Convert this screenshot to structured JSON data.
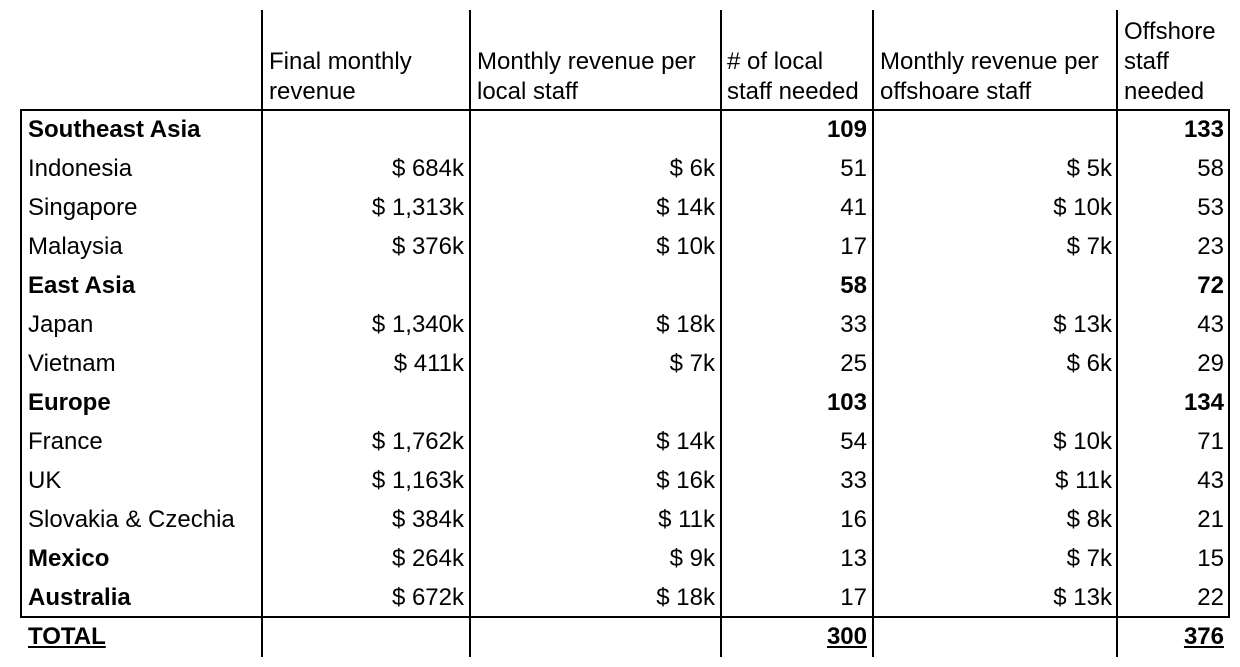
{
  "headers": {
    "final_revenue": "Final monthly\nrevenue",
    "rev_per_local": "Monthly revenue per\nlocal staff",
    "local_needed": "# of local\nstaff needed",
    "rev_per_offshore": "Monthly revenue per\noffshoare staff",
    "offshore_needed": "Offshore\nstaff\nneeded"
  },
  "rows": [
    {
      "name": "Southeast Asia",
      "bold": true,
      "revenue": "",
      "rev_local": "",
      "local": "109",
      "rev_offshore": "",
      "offshore": "133"
    },
    {
      "name": "Indonesia",
      "bold": false,
      "revenue": "$ 684k",
      "rev_local": "$ 6k",
      "local": "51",
      "rev_offshore": "$ 5k",
      "offshore": "58"
    },
    {
      "name": "Singapore",
      "bold": false,
      "revenue": "$ 1,313k",
      "rev_local": "$ 14k",
      "local": "41",
      "rev_offshore": "$ 10k",
      "offshore": "53"
    },
    {
      "name": "Malaysia",
      "bold": false,
      "revenue": "$ 376k",
      "rev_local": "$ 10k",
      "local": "17",
      "rev_offshore": "$ 7k",
      "offshore": "23"
    },
    {
      "name": "East Asia",
      "bold": true,
      "revenue": "",
      "rev_local": "",
      "local": "58",
      "rev_offshore": "",
      "offshore": "72"
    },
    {
      "name": "Japan",
      "bold": false,
      "revenue": "$ 1,340k",
      "rev_local": "$ 18k",
      "local": "33",
      "rev_offshore": "$ 13k",
      "offshore": "43"
    },
    {
      "name": "Vietnam",
      "bold": false,
      "revenue": "$ 411k",
      "rev_local": "$ 7k",
      "local": "25",
      "rev_offshore": "$ 6k",
      "offshore": "29"
    },
    {
      "name": "Europe",
      "bold": true,
      "revenue": "",
      "rev_local": "",
      "local": "103",
      "rev_offshore": "",
      "offshore": "134"
    },
    {
      "name": "France",
      "bold": false,
      "revenue": "$ 1,762k",
      "rev_local": "$ 14k",
      "local": "54",
      "rev_offshore": "$ 10k",
      "offshore": "71"
    },
    {
      "name": "UK",
      "bold": false,
      "revenue": "$ 1,163k",
      "rev_local": "$ 16k",
      "local": "33",
      "rev_offshore": "$ 11k",
      "offshore": "43"
    },
    {
      "name": "Slovakia & Czechia",
      "bold": false,
      "revenue": "$ 384k",
      "rev_local": "$ 11k",
      "local": "16",
      "rev_offshore": "$ 8k",
      "offshore": "21"
    },
    {
      "name": "Mexico",
      "bold": "name",
      "revenue": "$ 264k",
      "rev_local": "$ 9k",
      "local": "13",
      "rev_offshore": "$ 7k",
      "offshore": "15"
    },
    {
      "name": "Australia",
      "bold": "name",
      "revenue": "$ 672k",
      "rev_local": "$ 18k",
      "local": "17",
      "rev_offshore": "$ 13k",
      "offshore": "22"
    }
  ],
  "total": {
    "name": "TOTAL",
    "local": "300",
    "offshore": "376"
  }
}
